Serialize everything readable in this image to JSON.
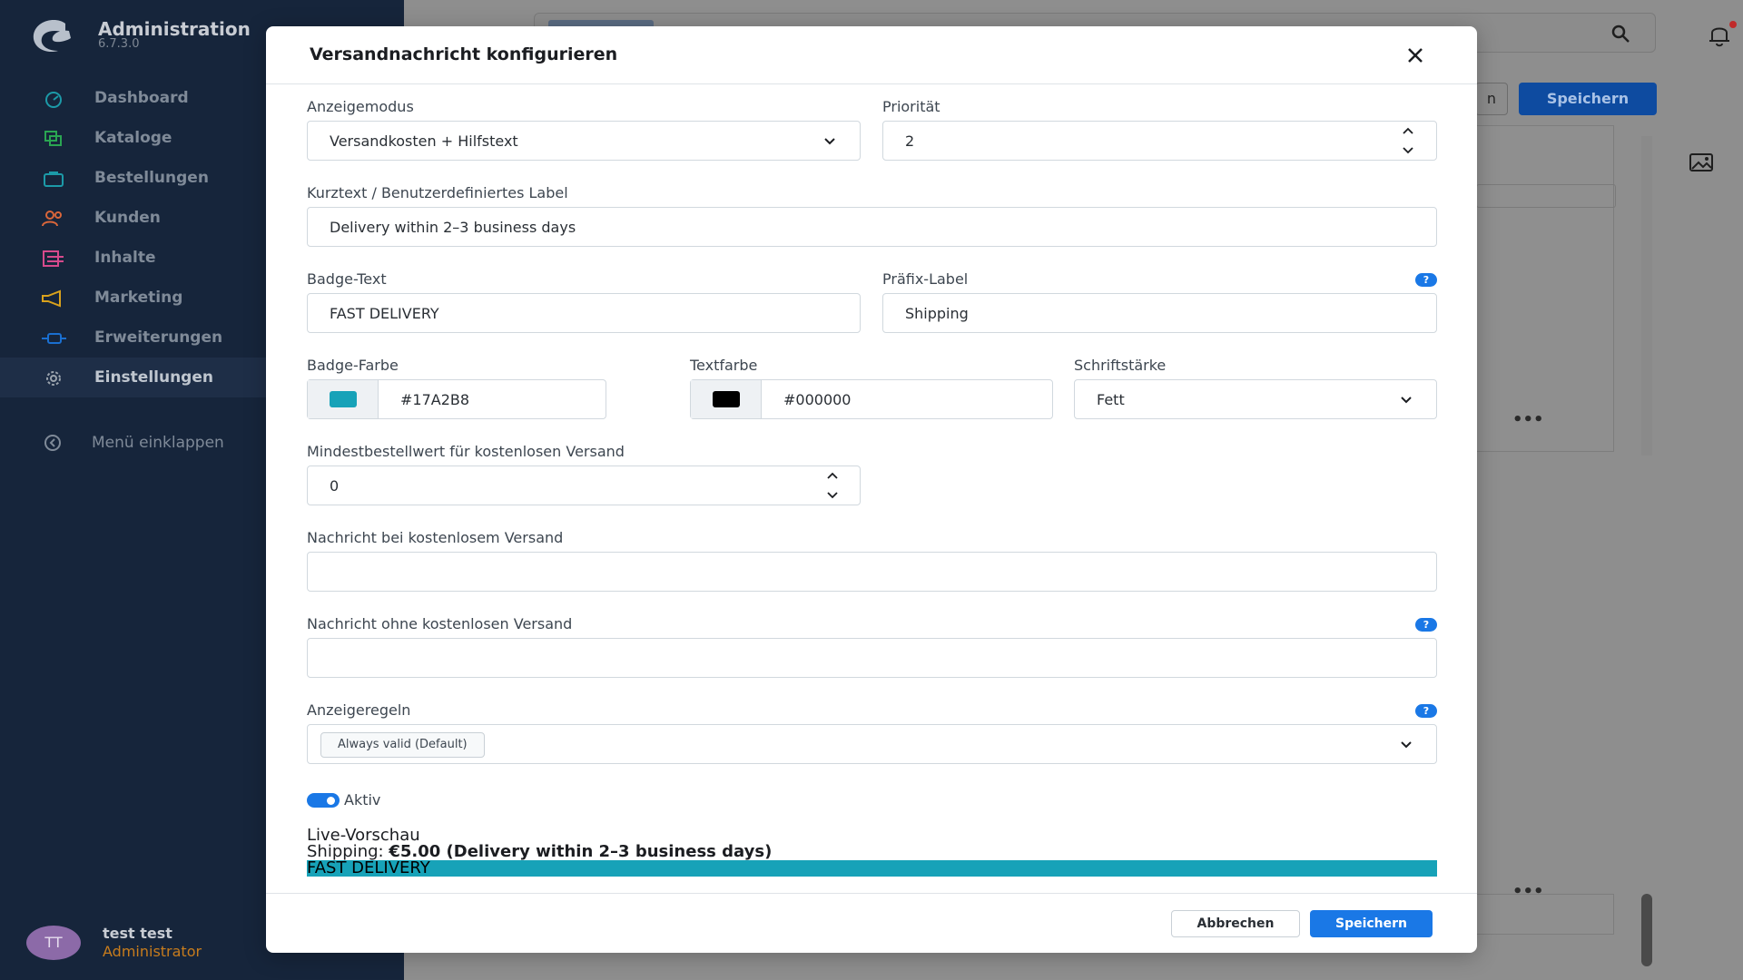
{
  "app": {
    "title": "Administration",
    "version": "6.7.3.0"
  },
  "sidebar": {
    "items": [
      {
        "label": "Dashboard",
        "icon": "gauge-icon",
        "color": "#1c9aa8"
      },
      {
        "label": "Kataloge",
        "icon": "catalog-icon",
        "color": "#2aa552"
      },
      {
        "label": "Bestellungen",
        "icon": "shopping-bag-icon",
        "color": "#1c9aa8"
      },
      {
        "label": "Kunden",
        "icon": "users-icon",
        "color": "#d9663a"
      },
      {
        "label": "Inhalte",
        "icon": "content-icon",
        "color": "#d64a8c"
      },
      {
        "label": "Marketing",
        "icon": "megaphone-icon",
        "color": "#d9a21c"
      },
      {
        "label": "Erweiterungen",
        "icon": "plug-icon",
        "color": "#1a6fd0"
      },
      {
        "label": "Einstellungen",
        "icon": "gear-icon",
        "color": "#9aa3ad"
      }
    ],
    "collapse_label": "Menü einklappen",
    "user": {
      "initials": "TT",
      "name": "test test",
      "role": "Administrator"
    }
  },
  "background": {
    "save_label": "Speichern",
    "ghost_label": "n"
  },
  "modal": {
    "title": "Versandnachricht konfigurieren",
    "display_mode": {
      "label": "Anzeigemodus",
      "value": "Versandkosten + Hilfstext"
    },
    "priority": {
      "label": "Priorität",
      "value": "2"
    },
    "short_text": {
      "label": "Kurztext / Benutzerdefiniertes Label",
      "value": "Delivery within 2–3 business days"
    },
    "badge_text": {
      "label": "Badge-Text",
      "value": "FAST DELIVERY"
    },
    "prefix_label": {
      "label": "Präfix-Label",
      "value": "Shipping"
    },
    "badge_color": {
      "label": "Badge-Farbe",
      "value": "#17A2B8"
    },
    "text_color": {
      "label": "Textfarbe",
      "value": "#000000"
    },
    "font_weight": {
      "label": "Schriftstärke",
      "value": "Fett"
    },
    "min_order": {
      "label": "Mindestbestellwert für kostenlosen Versand",
      "value": "0"
    },
    "msg_free": {
      "label": "Nachricht bei kostenlosem Versand",
      "value": ""
    },
    "msg_no_free": {
      "label": "Nachricht ohne kostenlosen Versand",
      "value": ""
    },
    "display_rules": {
      "label": "Anzeigeregeln",
      "tag": "Always valid (Default)"
    },
    "active": {
      "label": "Aktiv",
      "on": true
    },
    "preview": {
      "title": "Live-Vorschau",
      "prefix": "Shipping:",
      "text": "€5.00 (Delivery within 2–3 business days)",
      "badge": "FAST DELIVERY"
    },
    "help_symbol": "?",
    "cancel_label": "Abbrechen",
    "save_label": "Speichern"
  },
  "colors": {
    "accent": "#1a78e6",
    "badge": "#17A2B8",
    "sidebar_bg": "#16253b",
    "user_role": "#c77c1d"
  }
}
